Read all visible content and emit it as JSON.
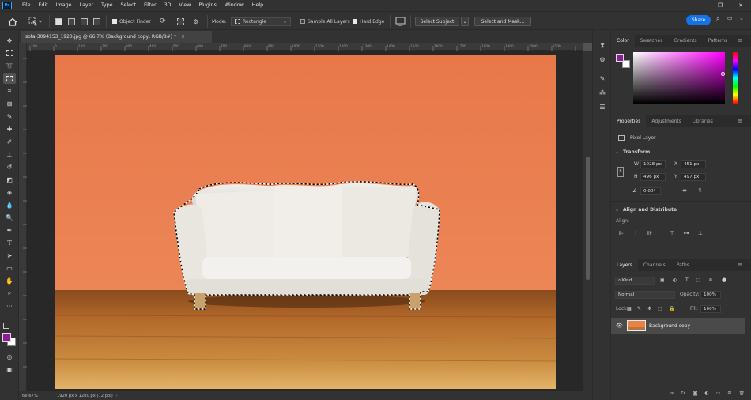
{
  "menubar": {
    "logo": "Ps",
    "items": [
      "File",
      "Edit",
      "Image",
      "Layer",
      "Type",
      "Select",
      "Filter",
      "3D",
      "View",
      "Plugins",
      "Window",
      "Help"
    ],
    "window_controls": [
      "—",
      "❐",
      "✕"
    ]
  },
  "options": {
    "object_finder_label": "Object Finder",
    "mode_label": "Mode:",
    "mode_value": "Rectangle",
    "sample_all_layers_label": "Sample All Layers",
    "hard_edge_label": "Hard Edge",
    "select_subject_label": "Select Subject",
    "select_and_mask_label": "Select and Mask...",
    "share_label": "Share"
  },
  "document": {
    "tab_title": "sofa-3094153_1920.jpg @ 66.7% (Background copy, RGB/8#) *",
    "close_glyph": "×",
    "zoom_status": "66.67%",
    "size_status": "1920 px x 1280 px (72 ppi)",
    "ruler_ticks": [
      "100",
      "0",
      "100",
      "200",
      "300",
      "400",
      "500",
      "600",
      "700",
      "800",
      "900",
      "1000",
      "1100",
      "1200",
      "1300",
      "1400",
      "1500",
      "1600",
      "1700",
      "1800",
      "1900",
      "2000",
      "2100"
    ]
  },
  "colors": {
    "foreground": "#8d1b9a",
    "background": "#ffffff",
    "wall": "#ea7d4f",
    "accent": "#1473e6"
  },
  "color_panel": {
    "tabs": [
      "Color",
      "Swatches",
      "Gradients",
      "Patterns"
    ],
    "picked_hue": "#ff00ff"
  },
  "properties": {
    "tabs": [
      "Properties",
      "Adjustments",
      "Libraries"
    ],
    "layer_type": "Pixel Layer",
    "transform_heading": "Transform",
    "w_label": "W",
    "w_value": "1028 px",
    "h_label": "H",
    "h_value": "496 px",
    "x_label": "X",
    "x_value": "451 px",
    "y_label": "Y",
    "y_value": "497 px",
    "angle_value": "0.00°",
    "align_heading": "Align and Distribute",
    "align_label": "Align:"
  },
  "layers": {
    "tabs": [
      "Layers",
      "Channels",
      "Paths"
    ],
    "filter_kind": "Kind",
    "blend_mode": "Normal",
    "opacity_label": "Opacity:",
    "opacity_value": "100%",
    "lock_label": "Lock:",
    "fill_label": "Fill:",
    "fill_value": "100%",
    "items": [
      {
        "name": "Background copy",
        "visible": true,
        "selected": true
      }
    ]
  }
}
